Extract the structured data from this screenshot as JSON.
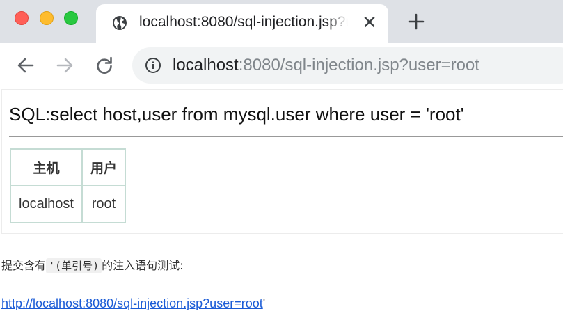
{
  "browser": {
    "tab": {
      "title": "localhost:8080/sql-injection.jsp?user=root",
      "favicon": "globe-icon",
      "close_glyph": "✕"
    },
    "new_tab_icon": "plus-icon",
    "nav": {
      "back_icon": "arrow-left-icon",
      "forward_icon": "arrow-right-icon",
      "reload_icon": "reload-icon"
    },
    "address": {
      "info_icon": "info-icon",
      "host": "localhost",
      "rest": ":8080/sql-injection.jsp?user=root"
    }
  },
  "page": {
    "sql": "SQL:select host,user from mysql.user where user = 'root'",
    "table": {
      "headers": [
        "主机",
        "用户"
      ],
      "rows": [
        [
          "localhost",
          "root"
        ]
      ]
    },
    "note": {
      "before": "提交含有",
      "code": "'(单引号)",
      "after": "的注入语句测试:"
    },
    "link": {
      "href_text": "http://localhost:8080/sql-injection.jsp?user=root",
      "tail": "'"
    }
  },
  "colors": {
    "tabstrip": "#dee1e6",
    "omnibox": "#f1f3f4",
    "table_border": "#c5dcd4",
    "link": "#1a5bd6"
  }
}
